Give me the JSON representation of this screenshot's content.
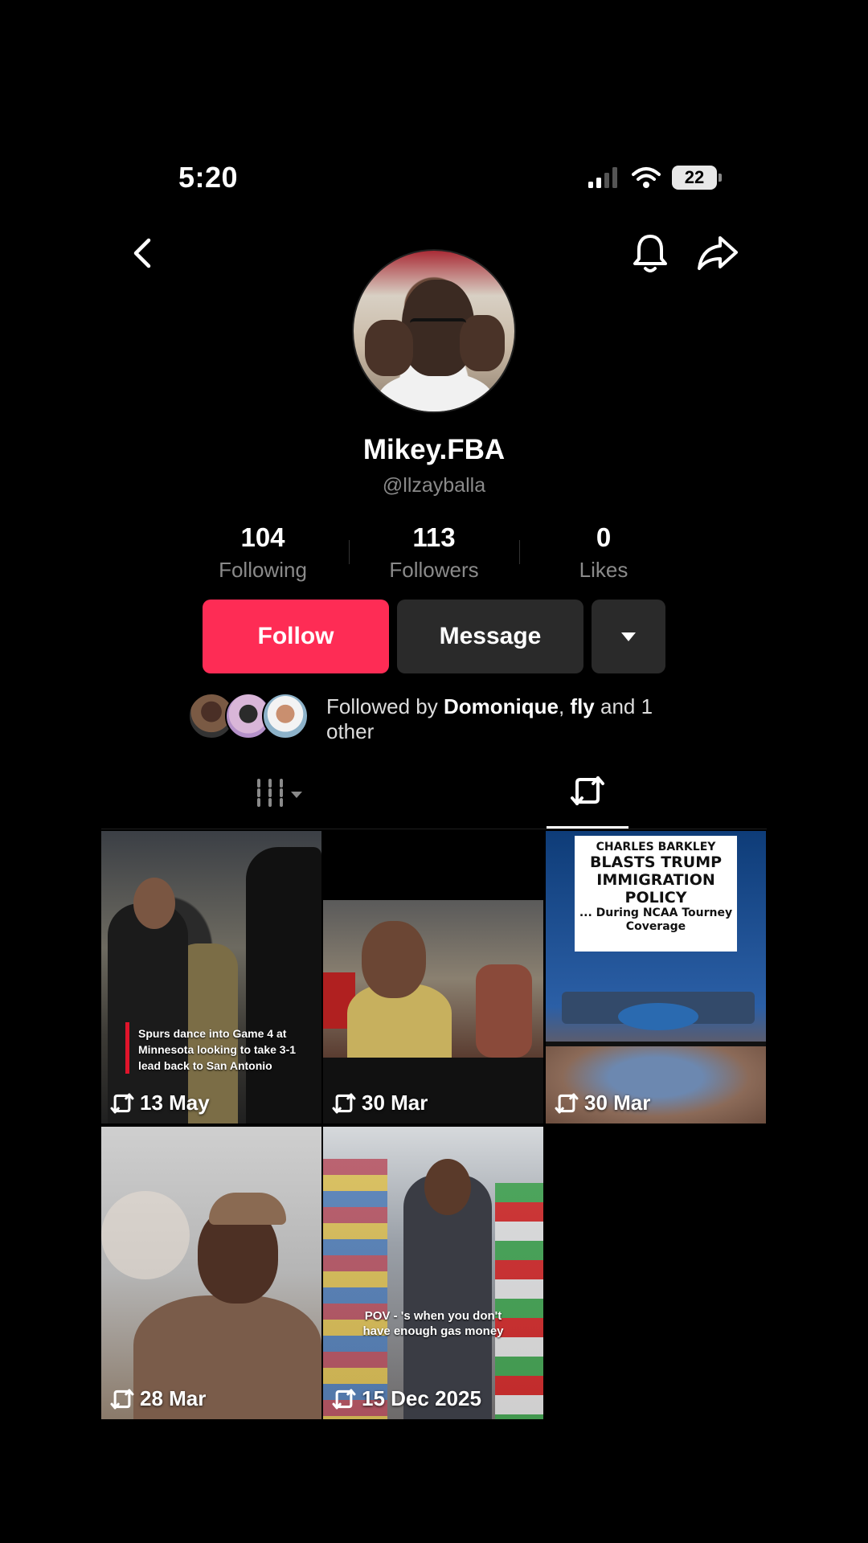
{
  "status_bar": {
    "time": "5:20",
    "battery": "22"
  },
  "profile": {
    "display_name": "Mikey.FBA",
    "handle": "@llzayballa"
  },
  "stats": [
    {
      "value": "104",
      "label": "Following"
    },
    {
      "value": "113",
      "label": "Followers"
    },
    {
      "value": "0",
      "label": "Likes"
    }
  ],
  "actions": {
    "follow": "Follow",
    "message": "Message"
  },
  "followed_by": {
    "prefix": "Followed by ",
    "name1": "Domonique",
    "sep": ", ",
    "name2": "fly",
    "suffix": " and 1 other"
  },
  "reposts": [
    {
      "date": "13 May",
      "overlay": "Spurs dance into Game 4 at Minnesota looking to take 3-1 lead back to San Antonio"
    },
    {
      "date": "30 Mar"
    },
    {
      "date": "30 Mar",
      "headline_small": "CHARLES BARKLEY",
      "headline_big": "BLASTS TRUMP IMMIGRATION POLICY",
      "headline_sub": "... During NCAA Tourney Coverage"
    },
    {
      "date": "28 Mar"
    },
    {
      "date": "15 Dec 2025",
      "overlay": "POV - 's when you don't have enough gas money"
    }
  ],
  "colors": {
    "accent": "#fe2c55",
    "background": "#000000",
    "secondary_text": "#8a8a8a",
    "button_dark": "#2a2a2a"
  }
}
